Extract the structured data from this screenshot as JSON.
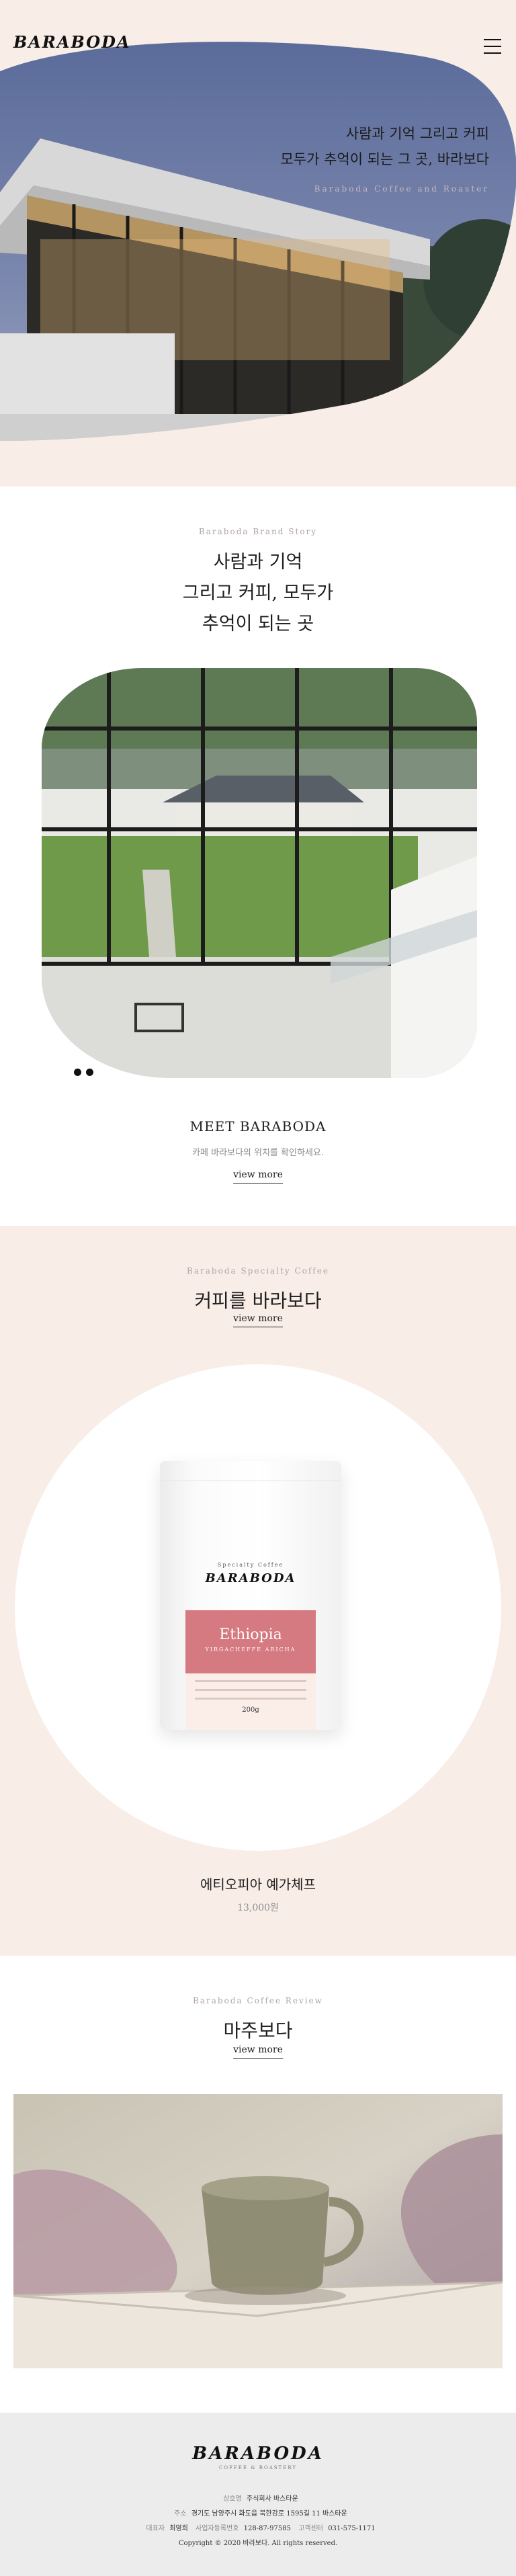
{
  "hero": {
    "logo": "BARABODA",
    "line1": "사람과 기억 그리고 커피",
    "line2": "모두가 추억이 되는 그 곳, 바라보다",
    "sub": "Baraboda Coffee and Roaster"
  },
  "story": {
    "eyebrow": "Baraboda Brand Story",
    "title_line1": "사람과 기억",
    "title_line2": "그리고 커피, 모두가",
    "title_line3": "추억이 되는 곳",
    "meet_title": "MEET BARABODA",
    "meet_desc": "카페 바라보다의 위치를 확인하세요.",
    "view_more": "view more"
  },
  "coffee": {
    "eyebrow": "Baraboda Specialty Coffee",
    "title": "커피를 바라보다",
    "view_more": "view more",
    "bag": {
      "specialty": "Specialty Coffee",
      "logo": "BARABODA",
      "origin": "Ethiopia",
      "region": "YIRGACHEFFE ARICHA",
      "weight": "200g"
    },
    "product_name": "에티오피아 예가체프",
    "price": "13,000원"
  },
  "review": {
    "eyebrow": "Baraboda Coffee Review",
    "title": "마주보다",
    "view_more": "view more"
  },
  "footer": {
    "logo": "BARABODA",
    "logo_sub": "COFFEE & ROASTERY",
    "company_label": "상호명",
    "company": "주식회사 바스타운",
    "address_label": "주소",
    "address": "경기도 남양주시 화도읍 북한강로 1595길 11 바스타운",
    "ceo_label": "대표자",
    "ceo": "최영희",
    "biz_label": "사업자등록번호",
    "biz": "128-87-97585",
    "tel_label": "고객센터",
    "tel": "031-575-1171",
    "copyright": "Copyright © 2020 바라보다. All rights reserved."
  },
  "colors": {
    "blush": "#f8ede7",
    "label_pink": "#d47a80",
    "footer_bg": "#ececec"
  }
}
